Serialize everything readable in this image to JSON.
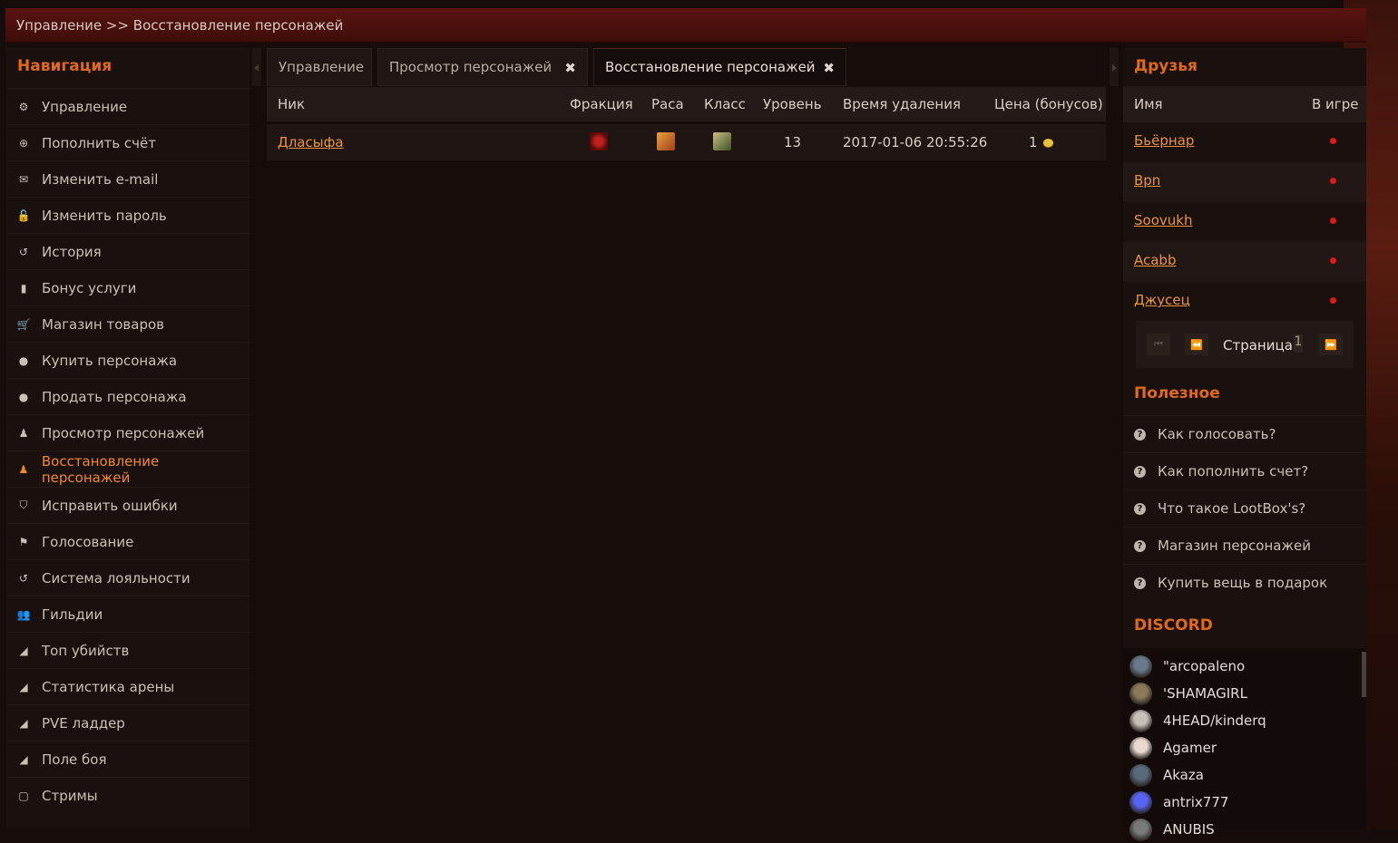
{
  "breadcrumb": "Управление >> Восстановление персонажей",
  "nav": {
    "title": "Навигация",
    "items": [
      {
        "label": "Управление",
        "icon": "gear-icon",
        "glyph": "⚙"
      },
      {
        "label": "Пополнить счёт",
        "icon": "plus-circle-icon",
        "glyph": "⊕"
      },
      {
        "label": "Изменить e-mail",
        "icon": "envelope-icon",
        "glyph": "✉"
      },
      {
        "label": "Изменить пароль",
        "icon": "lock-icon",
        "glyph": "🔓"
      },
      {
        "label": "История",
        "icon": "history-icon",
        "glyph": "↺"
      },
      {
        "label": "Бонус услуги",
        "icon": "bonus-icon",
        "glyph": "▮"
      },
      {
        "label": "Магазин товаров",
        "icon": "cart-icon",
        "glyph": "🛒"
      },
      {
        "label": "Купить персонажа",
        "icon": "user-icon",
        "glyph": "●"
      },
      {
        "label": "Продать персонажа",
        "icon": "user-icon",
        "glyph": "●"
      },
      {
        "label": "Просмотр персонажей",
        "icon": "person-icon",
        "glyph": "♟"
      },
      {
        "label": "Восстановление персонажей",
        "icon": "person-icon",
        "glyph": "♟",
        "active": true
      },
      {
        "label": "Исправить ошибки",
        "icon": "shield-icon",
        "glyph": "⛉"
      },
      {
        "label": "Голосование",
        "icon": "flag-icon",
        "glyph": "⚑"
      },
      {
        "label": "Система лояльности",
        "icon": "history-icon",
        "glyph": "↺"
      },
      {
        "label": "Гильдии",
        "icon": "users-icon",
        "glyph": "👥"
      },
      {
        "label": "Топ убийств",
        "icon": "area-chart-icon",
        "glyph": "◢"
      },
      {
        "label": "Статистика арены",
        "icon": "area-chart-icon",
        "glyph": "◢"
      },
      {
        "label": "PVE ладдер",
        "icon": "area-chart-icon",
        "glyph": "◢"
      },
      {
        "label": "Поле боя",
        "icon": "area-chart-icon",
        "glyph": "◢"
      },
      {
        "label": "Стримы",
        "icon": "chat-icon",
        "glyph": "▢"
      }
    ]
  },
  "tabs": [
    {
      "label": "Управление"
    },
    {
      "label": "Просмотр персонажей"
    },
    {
      "label": "Восстановление персонажей"
    }
  ],
  "table": {
    "headers": {
      "nick": "Ник",
      "faction": "Фракция",
      "race": "Раса",
      "class": "Класс",
      "level": "Уровень",
      "deleted": "Время удаления",
      "price": "Цена (бонусов)"
    },
    "rows": [
      {
        "nick": "Дласыфа",
        "level": "13",
        "deleted": "2017-01-06 20:55:26",
        "price": "1",
        "faction_icon": "horde-icon",
        "race_icon": "race-icon",
        "class_icon": "class-icon"
      }
    ]
  },
  "friends": {
    "title": "Друзья",
    "col_name": "Имя",
    "col_ingame": "В игре",
    "items": [
      {
        "name": "Бьёрнар"
      },
      {
        "name": "Bpn"
      },
      {
        "name": "Soovukh"
      },
      {
        "name": "Acabb"
      },
      {
        "name": "Джусец"
      }
    ],
    "status_color": "#e01818",
    "pager": {
      "label": "Страница",
      "page": "1"
    }
  },
  "useful": {
    "title": "Полезное",
    "items": [
      {
        "label": "Как голосовать?"
      },
      {
        "label": "Как пополнить счет?"
      },
      {
        "label": "Что такое LootBox's?"
      },
      {
        "label": "Магазин персонажей"
      },
      {
        "label": "Купить вещь в подарок"
      }
    ]
  },
  "discord": {
    "title": "DISCORD",
    "members": [
      {
        "name": "\"arcopaleno",
        "color": "#6b7a8a"
      },
      {
        "name": "'SHAMAGIRL",
        "color": "#8a7a5a"
      },
      {
        "name": "4HEAD/kinderq",
        "color": "#c8c0b8"
      },
      {
        "name": "Agamer",
        "color": "#e8d8d0"
      },
      {
        "name": "Akaza",
        "color": "#5a6a7a"
      },
      {
        "name": "antrix777",
        "color": "#5865f2"
      },
      {
        "name": "ANUBIS",
        "color": "#7a7a7a"
      }
    ]
  },
  "colors": {
    "accent": "#e06a1a",
    "link": "#e8953e",
    "topbar": "#4e110e"
  }
}
